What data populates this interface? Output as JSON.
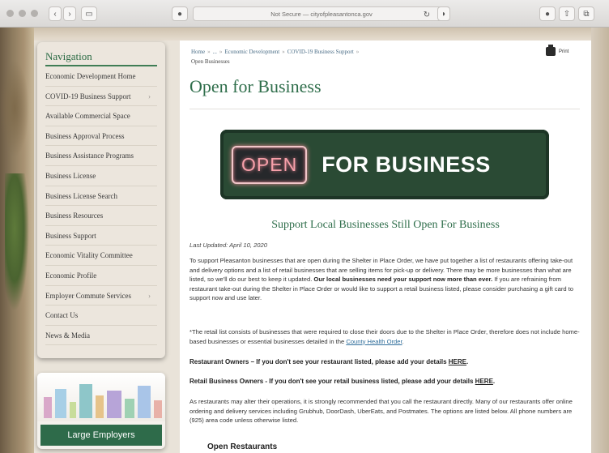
{
  "browser": {
    "address": "Not Secure — cityofpleasantonca.gov"
  },
  "sidebar": {
    "title": "Navigation",
    "items": [
      {
        "label": "Economic Development Home",
        "chevron": ""
      },
      {
        "label": "COVID-19 Business Support",
        "chevron": "›"
      },
      {
        "label": "Available Commercial Space",
        "chevron": ""
      },
      {
        "label": "Business Approval Process",
        "chevron": ""
      },
      {
        "label": "Business Assistance Programs",
        "chevron": ""
      },
      {
        "label": "Business License",
        "chevron": ""
      },
      {
        "label": "Business License Search",
        "chevron": ""
      },
      {
        "label": "Business Resources",
        "chevron": ""
      },
      {
        "label": "Business Support",
        "chevron": ""
      },
      {
        "label": "Economic Vitality Committee",
        "chevron": ""
      },
      {
        "label": "Economic Profile",
        "chevron": ""
      },
      {
        "label": "Employer Commute Services",
        "chevron": "›"
      },
      {
        "label": "Contact Us",
        "chevron": ""
      },
      {
        "label": "News & Media",
        "chevron": ""
      }
    ],
    "promo_label": "Large Employers"
  },
  "breadcrumb": {
    "home": "Home",
    "ellipsis": "...",
    "econ": "Economic Development",
    "covid": "COVID-19 Business Support",
    "current": "Open Businesses",
    "sep": "»"
  },
  "print_label": "Print",
  "page_title": "Open for Business",
  "banner": {
    "neon": "OPEN",
    "text": "FOR BUSINESS"
  },
  "subtitle": "Support Local Businesses Still Open For Business",
  "updated": "Last Updated: April 10, 2020",
  "intro": {
    "part1": "To support Pleasanton businesses that are open during the Shelter in Place Order, we have put together a list of restaurants offering take-out and delivery options and a list of retail businesses that are selling items for pick-up or delivery. There may be more businesses than what are listed, so we'll do our best to keep it updated. ",
    "bold": "Our local businesses need your support now more than ever.",
    "part2": " If you are refraining from restaurant take-out during the Shelter in Place Order or would like to support a retail business listed, please consider purchasing a gift card to support now and use later."
  },
  "retail_note": {
    "text": "*The retail list consists of businesses that were required to close their doors due to the Shelter in Place Order, therefore does not include home-based businesses or essential businesses detailed in the ",
    "link": "County Health Order",
    "end": "."
  },
  "restaurant_owners": {
    "text": "Restaurant Owners – If you don't see your restaurant listed, please add your details ",
    "link": "HERE",
    "end": "."
  },
  "retail_owners": {
    "text": "Retail Business Owners - If you don't see your retail business listed, please add your details ",
    "link": "HERE",
    "end": "."
  },
  "ordering_note": "As restaurants may alter their operations, it is strongly recommended that you call the restaurant directly. Many of our restaurants offer online ordering and delivery services including Grubhub, DoorDash, UberEats, and Postmates. The options are listed below. All phone numbers are (925) area code unless otherwise listed.",
  "section_heading": "Open Restaurants"
}
